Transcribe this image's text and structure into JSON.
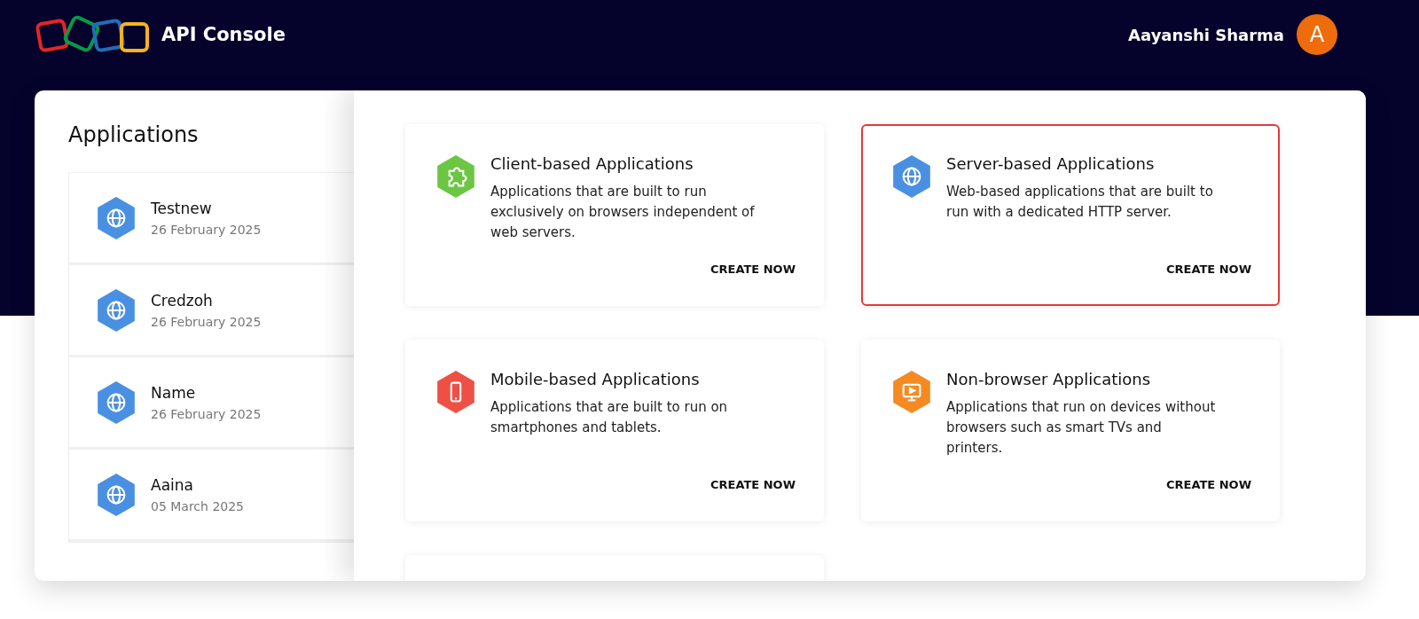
{
  "header": {
    "title": "API Console",
    "user_name": "Aayanshi Sharma",
    "avatar_initial": "A"
  },
  "sidebar": {
    "title": "Applications",
    "items": [
      {
        "name": "Testnew",
        "date": "26 February 2025"
      },
      {
        "name": "Credzoh",
        "date": "26 February 2025"
      },
      {
        "name": "Name",
        "date": "26 February 2025"
      },
      {
        "name": "Aaina",
        "date": "05 March 2025"
      }
    ]
  },
  "app_types": [
    {
      "kind": "puzzle",
      "color": "#6cc644",
      "title": "Client-based Applications",
      "description": "Applications that are built to run exclusively on browsers independent of web servers.",
      "action": "CREATE NOW",
      "highlighted": false
    },
    {
      "kind": "globe",
      "color": "#4a90e2",
      "title": "Server-based Applications",
      "description": "Web-based applications that are built to run with a dedicated HTTP server.",
      "action": "CREATE NOW",
      "highlighted": true
    },
    {
      "kind": "phone",
      "color": "#ef5045",
      "title": "Mobile-based Applications",
      "description": "Applications that are built to run on smartphones and tablets.",
      "action": "CREATE NOW",
      "highlighted": false
    },
    {
      "kind": "monitor",
      "color": "#f58a23",
      "title": "Non-browser Applications",
      "description": "Applications that run on devices without browsers such as smart TVs and printers.",
      "action": "CREATE NOW",
      "highlighted": false
    }
  ]
}
